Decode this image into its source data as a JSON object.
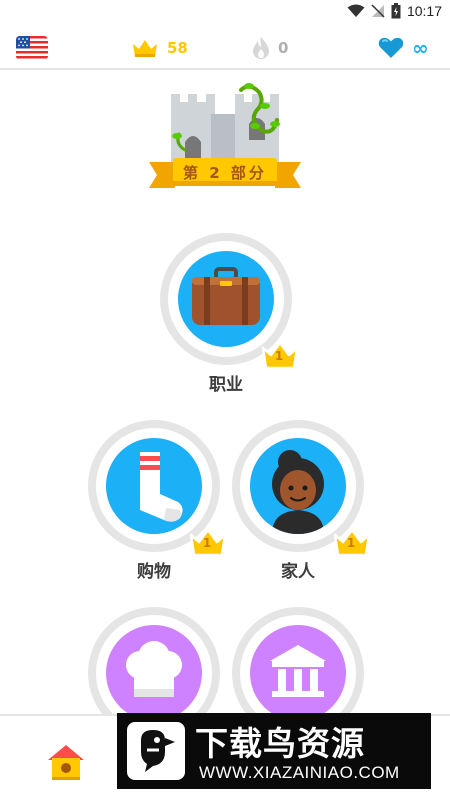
{
  "status_bar": {
    "time": "10:17"
  },
  "top_bar": {
    "flag": "us-flag-icon",
    "crowns": "58",
    "streak": "0",
    "hearts": "∞"
  },
  "unit_banner": {
    "label": "第 2 部分"
  },
  "skills": [
    {
      "name": "职业",
      "crown_level": "1",
      "icon": "suitcase-icon",
      "color": "#1cb0f6"
    },
    {
      "name": "购物",
      "crown_level": "1",
      "icon": "sock-icon",
      "color": "#1cb0f6"
    },
    {
      "name": "家人",
      "crown_level": "1",
      "icon": "person-icon",
      "color": "#1cb0f6"
    },
    {
      "name": "",
      "icon": "chef-hat-icon",
      "color": "#ce82ff"
    },
    {
      "name": "",
      "icon": "building-icon",
      "color": "#ce82ff"
    }
  ],
  "bottom_nav": {
    "home": "home-icon"
  },
  "watermark": {
    "title": "下载鸟资源",
    "url": "WWW.XIAZAINIAO.COM"
  },
  "colors": {
    "crown": "#ffc800",
    "blue": "#1cb0f6",
    "purple": "#ce82ff",
    "border": "#e5e5e5"
  }
}
